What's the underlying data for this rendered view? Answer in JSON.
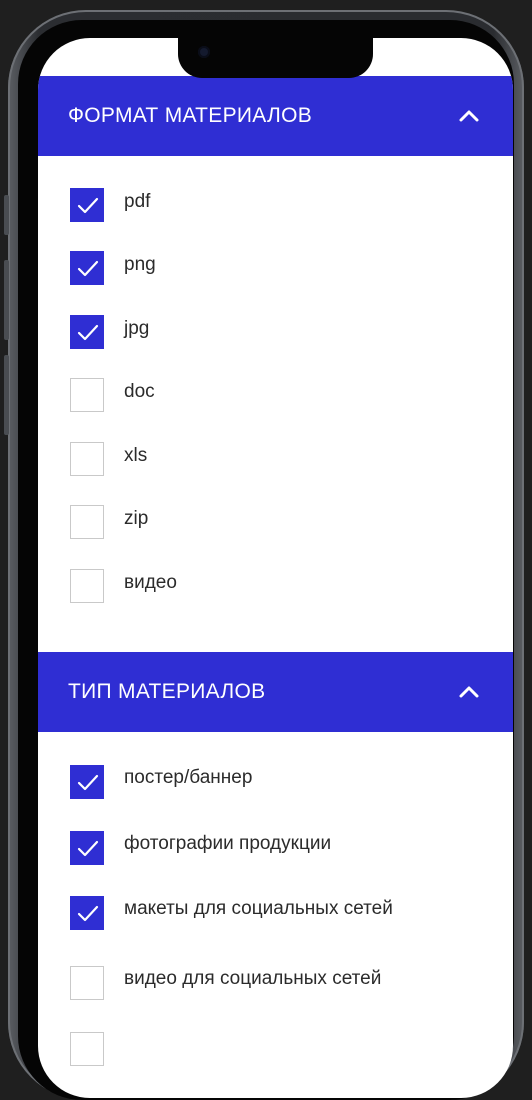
{
  "colors": {
    "accent": "#2f2ed3",
    "checkbox_border": "#c9c9c9",
    "text": "#2b2b2b"
  },
  "sections": [
    {
      "title": "ФОРМАТ МАТЕРИАЛОВ",
      "toggle_icon": "chevron-up-icon",
      "items": [
        {
          "label": "pdf",
          "checked": true
        },
        {
          "label": "png",
          "checked": true
        },
        {
          "label": "jpg",
          "checked": true
        },
        {
          "label": "doc",
          "checked": false
        },
        {
          "label": "xls",
          "checked": false
        },
        {
          "label": "zip",
          "checked": false
        },
        {
          "label": "видео",
          "checked": false
        }
      ]
    },
    {
      "title": "ТИП МАТЕРИАЛОВ",
      "toggle_icon": "chevron-up-icon",
      "items": [
        {
          "label": "постер/баннер",
          "checked": true
        },
        {
          "label": "фотографии продукции",
          "checked": true
        },
        {
          "label": "макеты для социальных сетей",
          "checked": true
        },
        {
          "label": "видео для социальных сетей",
          "checked": false
        },
        {
          "label": "",
          "checked": false
        }
      ]
    }
  ]
}
